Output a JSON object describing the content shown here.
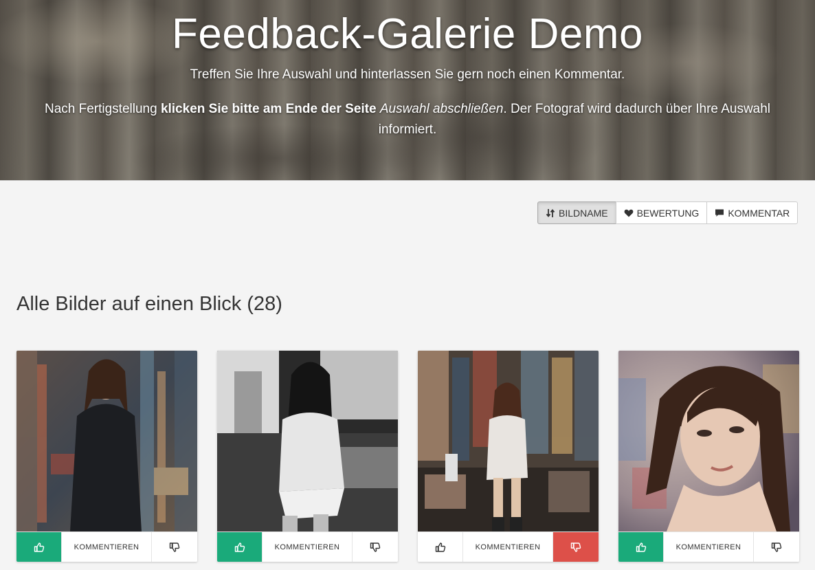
{
  "hero": {
    "title": "Feedback-Galerie Demo",
    "subtitle": "Treffen Sie Ihre Auswahl und hinterlassen Sie gern noch einen Kommentar.",
    "info_prefix": "Nach Fertigstellung ",
    "info_bold": "klicken Sie bitte am Ende der Seite",
    "info_space": " ",
    "info_italic": "Auswahl abschließen",
    "info_suffix": ". Der Fotograf wird dadurch über Ihre Auswahl informiert."
  },
  "sort": {
    "active": "bildname",
    "buttons": [
      {
        "label": "BILDNAME",
        "icon": "sort-arrows-icon"
      },
      {
        "label": "BEWERTUNG",
        "icon": "heart-icon"
      },
      {
        "label": "KOMMENTAR",
        "icon": "speech-bubble-icon"
      }
    ]
  },
  "gallery": {
    "title": "Alle Bilder auf einen Blick (28)",
    "cards": [
      {
        "comment_label": "KOMMENTIEREN",
        "liked": true,
        "disliked": false
      },
      {
        "comment_label": "KOMMENTIEREN",
        "liked": true,
        "disliked": false
      },
      {
        "comment_label": "KOMMENTIEREN",
        "liked": false,
        "disliked": true
      },
      {
        "comment_label": "KOMMENTIEREN",
        "liked": true,
        "disliked": false
      }
    ]
  },
  "colors": {
    "like_active": "#1aaa7a",
    "dislike_active": "#dd5049",
    "page_bg": "#f4f4f4"
  }
}
